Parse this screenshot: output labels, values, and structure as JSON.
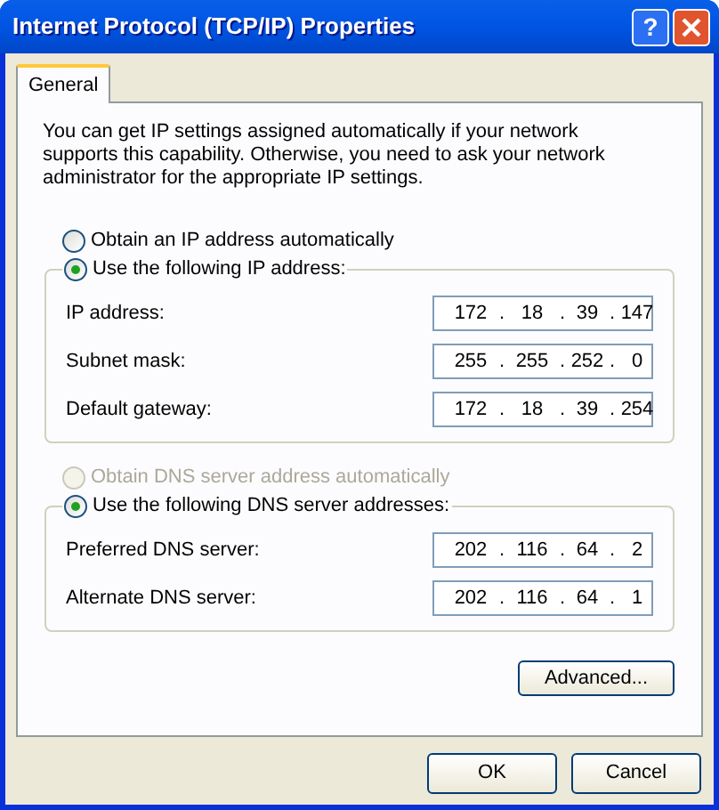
{
  "window": {
    "title": "Internet Protocol (TCP/IP) Properties",
    "buttons": [
      {
        "kind": "help",
        "label": "?"
      },
      {
        "kind": "close"
      }
    ]
  },
  "tabs": [
    {
      "label": "General",
      "selected": true
    }
  ],
  "intro": "You can get IP settings assigned automatically if your network supports this capability. Otherwise, you need to ask your network administrator for the appropriate IP settings.",
  "sections": [
    {
      "auto_option": {
        "label": "Obtain an IP address automatically",
        "selected": false,
        "disabled": false
      },
      "manual_option": {
        "label": "Use the following IP address:",
        "selected": true,
        "disabled": false
      },
      "fields": [
        {
          "label": "IP address:",
          "parts": [
            "172",
            ".",
            "18",
            ".",
            "39",
            ".",
            "147"
          ]
        },
        {
          "label": "Subnet mask:",
          "parts": [
            "255",
            ".",
            "255",
            ".",
            "252",
            ".",
            "0"
          ]
        },
        {
          "label": "Default gateway:",
          "parts": [
            "172",
            ".",
            "18",
            ".",
            "39",
            ".",
            "254"
          ]
        }
      ]
    },
    {
      "auto_option": {
        "label": "Obtain DNS server address automatically",
        "selected": false,
        "disabled": true
      },
      "manual_option": {
        "label": "Use the following DNS server addresses:",
        "selected": true,
        "disabled": false
      },
      "fields": [
        {
          "label": "Preferred DNS server:",
          "parts": [
            "202",
            ".",
            "116",
            ".",
            "64",
            ".",
            "2"
          ]
        },
        {
          "label": "Alternate DNS server:",
          "parts": [
            "202",
            ".",
            "116",
            ".",
            "64",
            ".",
            "1"
          ]
        }
      ]
    }
  ],
  "advanced_button": "Advanced...",
  "footer_buttons": [
    "OK",
    "Cancel"
  ]
}
